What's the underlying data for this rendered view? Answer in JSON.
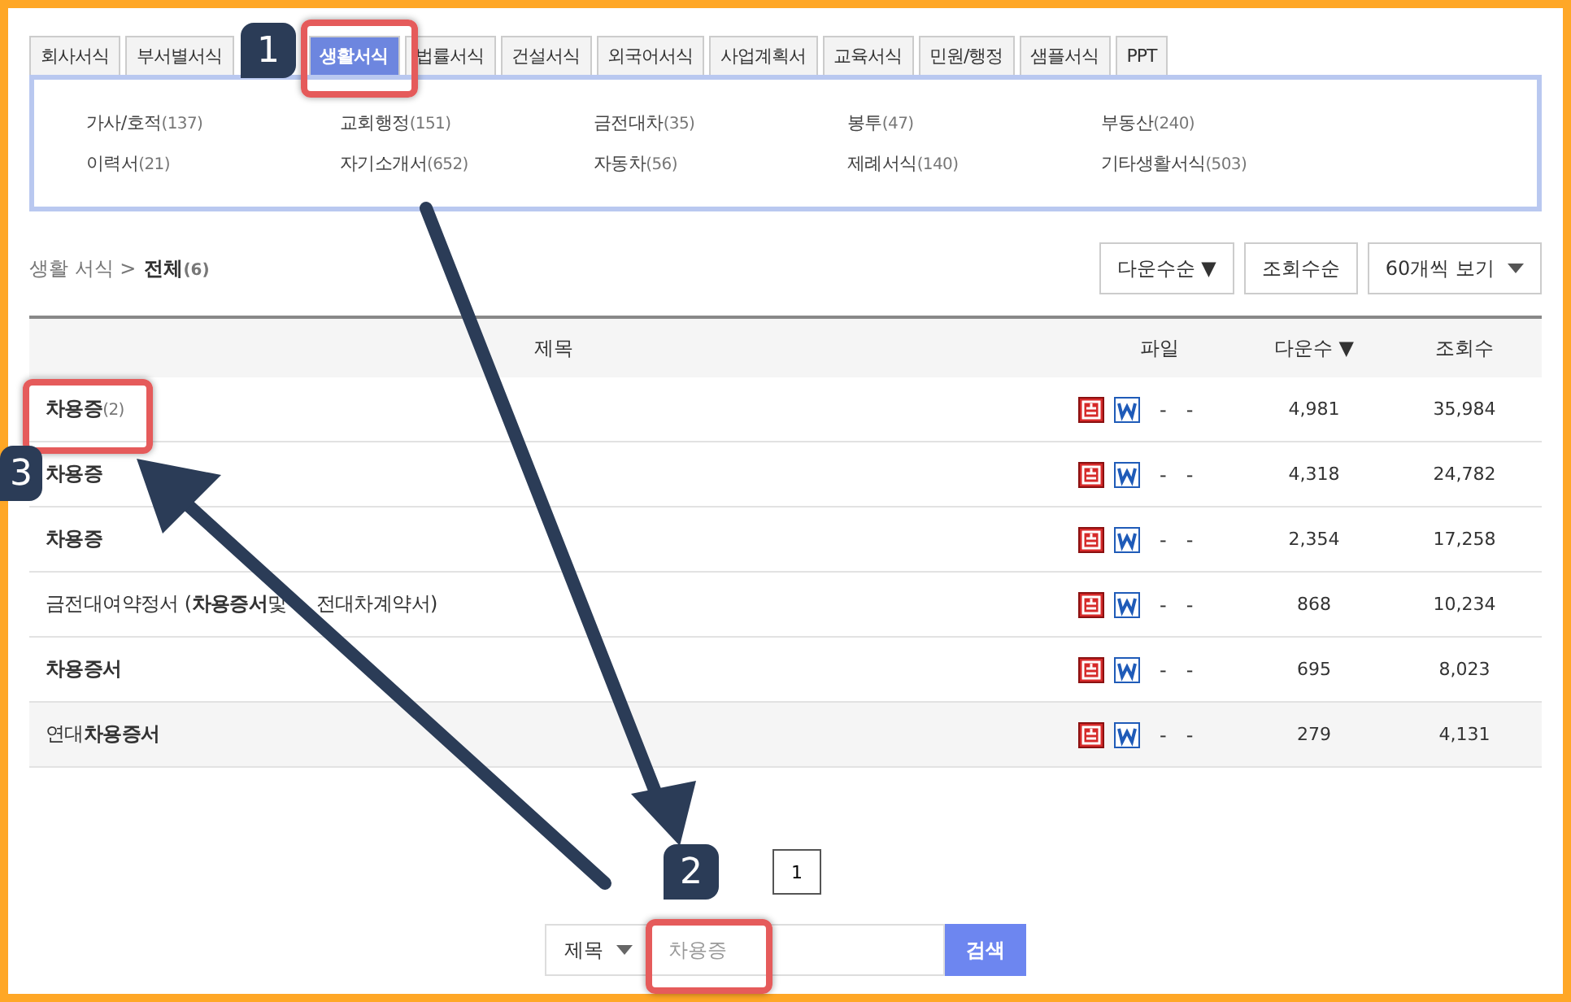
{
  "tabs": [
    {
      "label": "회사서식",
      "selected": false
    },
    {
      "label": "부서별서식",
      "selected": false
    },
    {
      "label": "생활서식",
      "selected": true
    },
    {
      "label": "법률서식",
      "selected": false
    },
    {
      "label": "건설서식",
      "selected": false
    },
    {
      "label": "외국어서식",
      "selected": false
    },
    {
      "label": "사업계획서",
      "selected": false
    },
    {
      "label": "교육서식",
      "selected": false
    },
    {
      "label": "민원/행정",
      "selected": false
    },
    {
      "label": "샘플서식",
      "selected": false
    },
    {
      "label": "PPT",
      "selected": false
    }
  ],
  "categories": [
    {
      "name": "가사/호적",
      "count": "(137)"
    },
    {
      "name": "교회행정",
      "count": "(151)"
    },
    {
      "name": "금전대차",
      "count": "(35)"
    },
    {
      "name": "봉투",
      "count": "(47)"
    },
    {
      "name": "부동산",
      "count": "(240)"
    },
    {
      "name": "이력서",
      "count": "(21)"
    },
    {
      "name": "자기소개서",
      "count": "(652)"
    },
    {
      "name": "자동차",
      "count": "(56)"
    },
    {
      "name": "제례서식",
      "count": "(140)"
    },
    {
      "name": "기타생활서식",
      "count": "(503)"
    }
  ],
  "breadcrumb": {
    "parent": "생활 서식 >",
    "current": "전체",
    "count": "(6)"
  },
  "sort_buttons": [
    {
      "label": "다운수순 ▼"
    },
    {
      "label": "조회수순"
    },
    {
      "label": "60개씩 보기"
    }
  ],
  "table": {
    "columns": [
      "제목",
      "파일",
      "다운수 ▼",
      "조회수"
    ],
    "rows": [
      {
        "title": "**차용증**",
        "count": "(2)",
        "dashes": [
          "-",
          "-"
        ],
        "downloads": "4,981",
        "views": "35,984"
      },
      {
        "title": "**차용증**",
        "dashes": [
          "-",
          "-"
        ],
        "downloads": "4,318",
        "views": "24,782"
      },
      {
        "title": "**차용증**",
        "dashes": [
          "-",
          "-"
        ],
        "downloads": "2,354",
        "views": "17,258"
      },
      {
        "title": "금전대여약정서 (**차용증서**및",
        "title_tail": "전대차계약서)",
        "dashes": [
          "-",
          "-"
        ],
        "downloads": "868",
        "views": "10,234"
      },
      {
        "title": "**차용증서**",
        "dashes": [
          "-",
          "-"
        ],
        "downloads": "695",
        "views": "8,023"
      },
      {
        "title": "연대**차용증서**",
        "dashes": [
          "-",
          "-"
        ],
        "downloads": "279",
        "views": "4,131"
      }
    ]
  },
  "pagination": [
    {
      "label": "1"
    }
  ],
  "search": {
    "field_select": "제목",
    "value": "차용증",
    "button": "검색"
  },
  "annotations": [
    {
      "number": "1"
    },
    {
      "number": "2"
    },
    {
      "number": "3"
    }
  ]
}
